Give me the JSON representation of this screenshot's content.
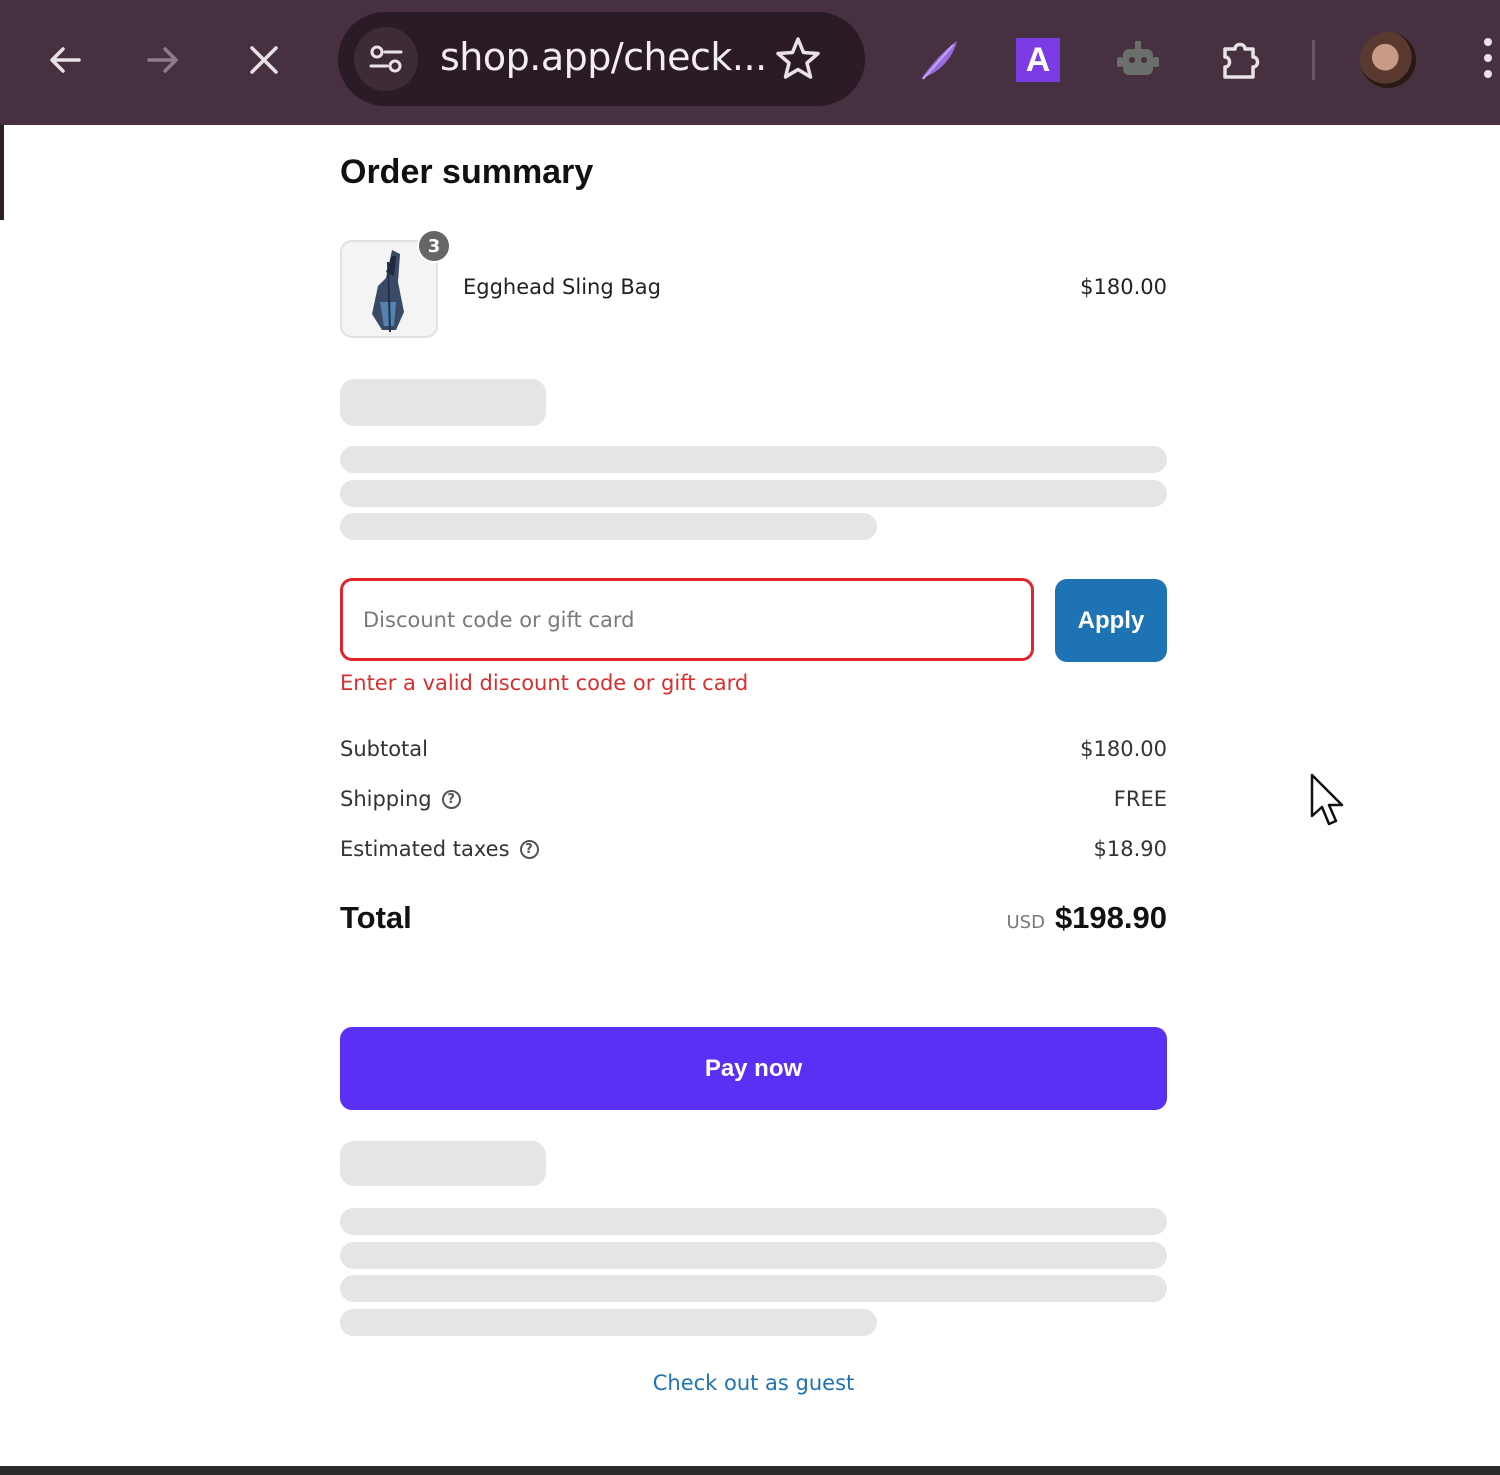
{
  "browser": {
    "url": "shop.app/check...",
    "colors": {
      "toolbar": "#47303f",
      "omnibox": "#2a1b26"
    },
    "extensions": [
      "feather-extension-icon",
      "a-extension-icon",
      "robot-extension-icon",
      "puzzle-extensions-icon"
    ],
    "a_extension_letter": "A"
  },
  "order": {
    "title": "Order summary",
    "item": {
      "name": "Egghead Sling Bag",
      "price": "$180.00",
      "quantity": "3"
    }
  },
  "discount": {
    "placeholder": "Discount code or gift card",
    "value": "",
    "apply_label": "Apply",
    "error": "Enter a valid discount code or gift card"
  },
  "totals": {
    "subtotal_label": "Subtotal",
    "subtotal_value": "$180.00",
    "shipping_label": "Shipping",
    "shipping_value": "FREE",
    "taxes_label": "Estimated taxes",
    "taxes_value": "$18.90",
    "total_label": "Total",
    "currency": "USD",
    "total_value": "$198.90"
  },
  "actions": {
    "pay_label": "Pay now",
    "guest_label": "Check out as guest"
  },
  "colors": {
    "pay_button": "#5a31f4",
    "apply_button": "#1e73b5",
    "error": "#d92f2f",
    "skeleton": "#e5e5e5"
  }
}
